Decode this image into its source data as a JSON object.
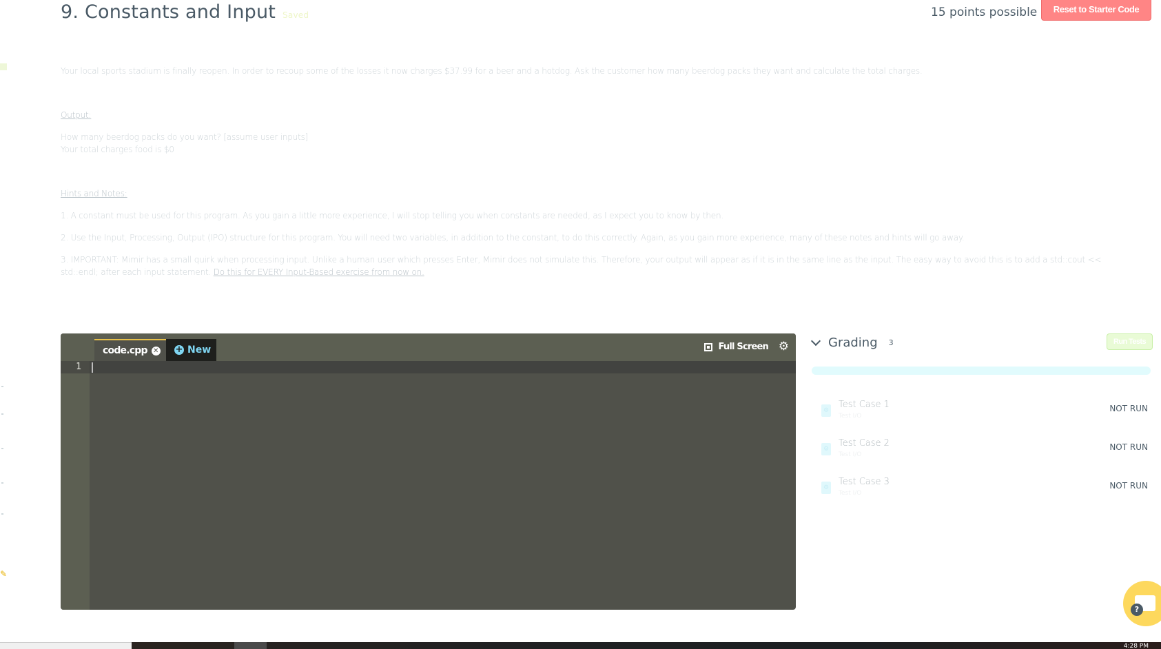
{
  "header": {
    "title": "9. Constants and Input",
    "saved_status": "Saved",
    "points": "15 points possible",
    "reset_button": "Reset to Starter Code"
  },
  "description": {
    "intro": "Your local sports stadium is finally reopen. In order to recoup some of the losses it now charges $37.99 for a beer and a hotdog. Ask the customer how many beerdog packs they want and calculate the total charges.",
    "output_heading": "Output:",
    "output_lines": [
      "How many beerdog packs do you want? [assume user inputs]",
      "Your total charges food is $0"
    ],
    "hints_heading": "Hints and Notes:",
    "hints": [
      "1. A constant must be used for this program. As you gain a little more experience, I will stop telling you when constants are needed, as I expect you to know by then.",
      "2. Use the Input, Processing, Output (IPO) structure for this program. You will need two variables, in addition to the constant, to do this correctly. Again, as you gain more experience, many of these notes and hints will go away.",
      "3. IMPORTANT: Mimir has a small quirk when processing input. Unlike a human user which presses Enter, Mimir does not simulate this. Therefore, your output will appear as if it is in the same line as the input. The easy way to avoid this is to add a  std::cout <<",
      "std::endl;  after each input statement. "
    ],
    "hint3_link": "Do this for EVERY Input-Based exercise from now on."
  },
  "editor": {
    "tab_file": "code.cpp",
    "tab_new": "New",
    "fullscreen_label": "Full Screen",
    "line_numbers": [
      "1"
    ],
    "code": ""
  },
  "grading": {
    "title": "Grading",
    "count": "3",
    "run_tests_button": "Run Tests",
    "progress": 0,
    "test_cases": [
      {
        "name": "Test Case 1",
        "sub": "Test I/O",
        "status": "NOT RUN"
      },
      {
        "name": "Test Case 2",
        "sub": "Test I/O",
        "status": "NOT RUN"
      },
      {
        "name": "Test Case 3",
        "sub": "Test I/O",
        "status": "NOT RUN"
      }
    ]
  },
  "taskbar": {
    "clock": "4:28 PM"
  },
  "colors": {
    "accent_red": "#ff8585",
    "run_tests_green": "#e9fbd6",
    "progress_track": "#e1fbfd",
    "editor_bg": "#50514a",
    "help_yellow": "#fdd85d",
    "new_tab_blue": "#7fd6f2"
  }
}
